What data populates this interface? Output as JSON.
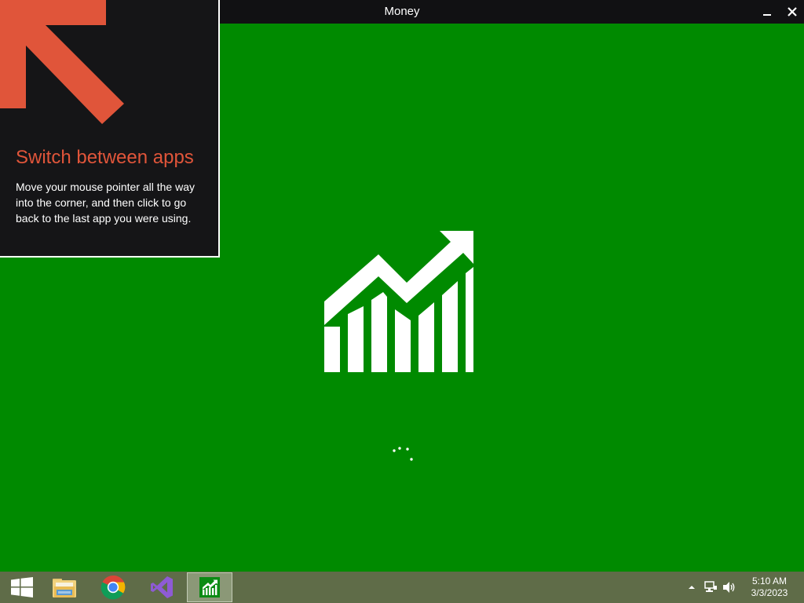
{
  "window": {
    "title": "Money",
    "minimize_label": "–",
    "close_label": "✕"
  },
  "tip": {
    "title": "Switch between apps",
    "body": "Move your mouse pointer all the way into the corner, and then click to go back to the last app you were using."
  },
  "taskbar": {
    "items": [
      {
        "name": "start",
        "icon": "windows-logo-icon"
      },
      {
        "name": "file-explorer",
        "icon": "folder-icon"
      },
      {
        "name": "chrome",
        "icon": "chrome-icon"
      },
      {
        "name": "visual-studio",
        "icon": "visual-studio-icon"
      },
      {
        "name": "money",
        "icon": "money-chart-icon",
        "active": true
      }
    ],
    "tray": {
      "time": "5:10 AM",
      "date": "3/3/2023"
    }
  },
  "colors": {
    "app_background": "#008a00",
    "titlebar": "#111113",
    "tip_background": "#151517",
    "tip_accent": "#e0553a",
    "taskbar": "#5f6c48"
  }
}
